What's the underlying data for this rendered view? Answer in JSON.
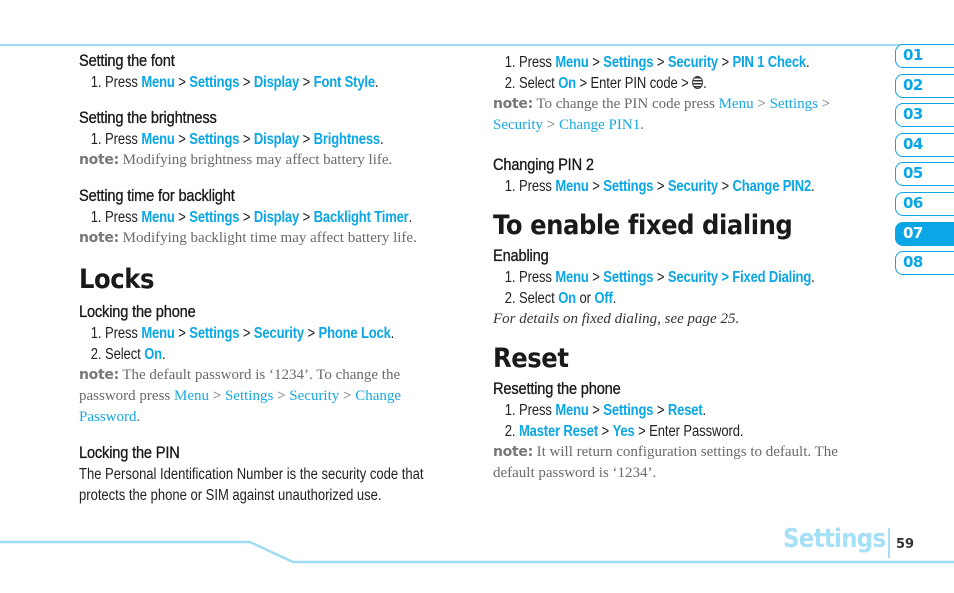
{
  "chapter_tabs": [
    {
      "label": "01",
      "active": false
    },
    {
      "label": "02",
      "active": false
    },
    {
      "label": "03",
      "active": false
    },
    {
      "label": "04",
      "active": false
    },
    {
      "label": "05",
      "active": false
    },
    {
      "label": "06",
      "active": false
    },
    {
      "label": "07",
      "active": true
    },
    {
      "label": "08",
      "active": false
    }
  ],
  "left": {
    "font": {
      "heading": "Setting the font",
      "step1": {
        "num": "1. Press ",
        "p1": "Menu",
        "s1": " > ",
        "p2": "Settings",
        "s2": " > ",
        "p3": "Display",
        "s3": " > ",
        "p4": "Font Style",
        "end": "."
      }
    },
    "brightness": {
      "heading": "Setting the brightness",
      "step1": {
        "num": "1. Press ",
        "p1": "Menu",
        "s1": " > ",
        "p2": "Settings",
        "s2": " > ",
        "p3": "Display",
        "s3": " > ",
        "p4": "Brightness",
        "end": "."
      },
      "note_label": "note:",
      "note": " Modifying brightness may affect battery life."
    },
    "backlight": {
      "heading": "Setting time for backlight",
      "step1": {
        "num": "1. Press ",
        "p1": "Menu",
        "s1": " > ",
        "p2": "Settings",
        "s2": " > ",
        "p3": "Display",
        "s3": " > ",
        "p4": "Backlight Timer",
        "end": "."
      },
      "note_label": "note:",
      "note": " Modifying backlight time may affect battery life."
    },
    "locks_title": "Locks",
    "lock_phone": {
      "heading": "Locking the phone",
      "step1": {
        "num": "1. Press ",
        "p1": "Menu",
        "s1": " > ",
        "p2": "Settings",
        "s2": " > ",
        "p3": "Security",
        "s3": " > ",
        "p4": "Phone Lock",
        "end": "."
      },
      "step2": {
        "num": "2. Select ",
        "p1": "On",
        "end": "."
      },
      "note_label": "note:",
      "note_text": " The default password is ‘1234’. To change the password press ",
      "note_l1": "Menu",
      "note_s1": " > ",
      "note_l2": "Settings",
      "note_s2": " > ",
      "note_l3": "Security",
      "note_s3": " > ",
      "note_l4": "Change Password",
      "note_end": "."
    },
    "lock_pin": {
      "heading": "Locking the PIN",
      "line1": "The Personal Identification Number is the security code that",
      "line2": "protects the phone or SIM against unauthorized use."
    }
  },
  "right": {
    "pin1": {
      "step1": {
        "num": "1. Press ",
        "p1": "Menu",
        "s1": " > ",
        "p2": "Settings",
        "s2": " > ",
        "p3": "Security",
        "s3": " > ",
        "p4": "PIN 1 Check",
        "end": "."
      },
      "step2": {
        "num": "2. Select ",
        "p1": "On",
        "mid": " > Enter PIN code > ",
        "icon": "att-globe-key-icon",
        "end": "."
      },
      "note_label": "note:",
      "note_text": " To change the PIN code press ",
      "note_l1": "Menu",
      "note_s1": " > ",
      "note_l2": "Settings",
      "note_s2": " > ",
      "note_l3": "Security",
      "note_s3": " > ",
      "note_l4": "Change PIN1",
      "note_end": "."
    },
    "pin2": {
      "heading": "Changing PIN 2",
      "step1": {
        "num": "1. Press ",
        "p1": "Menu",
        "s1": " > ",
        "p2": "Settings",
        "s2": " > ",
        "p3": "Security",
        "s3": " > ",
        "p4": "Change PIN2",
        "end": "."
      }
    },
    "fixed_title": "To enable fixed dialing",
    "enabling": {
      "heading": "Enabling",
      "step1": {
        "num": "1. Press ",
        "p1": "Menu",
        "s1": " > ",
        "p2": "Settings",
        "s2": " > ",
        "p3": "Security > Fixed Dialing",
        "end": "."
      },
      "step2": {
        "num": "2. Select ",
        "p1": "On",
        "mid": " or ",
        "p2": "Off",
        "end": "."
      },
      "italic": "For details on fixed dialing, see page 25."
    },
    "reset_title": "Reset",
    "resetting": {
      "heading": "Resetting the phone",
      "step1": {
        "num": "1. Press ",
        "p1": "Menu",
        "s1": " > ",
        "p2": "Settings",
        "s2": " > ",
        "p3": "Reset",
        "end": "."
      },
      "step2": {
        "num": "2. ",
        "p1": "Master Reset",
        "s1": " > ",
        "p2": "Yes",
        "mid": " > Enter Password."
      },
      "note_label": "note:",
      "note": " It will return configuration settings to default. The default password is ‘1234’."
    }
  },
  "footer": {
    "section": "Settings",
    "page": "59"
  },
  "colors": {
    "accent": "#0aa6e6",
    "rule": "#9fdcf3",
    "footer_title": "#a6e0f7"
  }
}
